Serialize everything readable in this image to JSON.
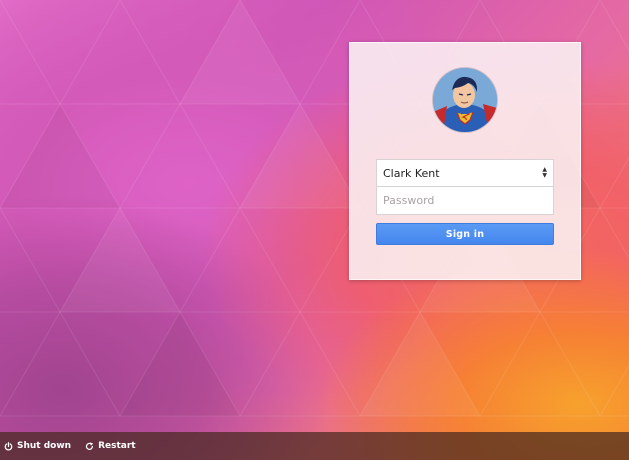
{
  "login": {
    "username": "Clark Kent",
    "password_placeholder": "Password",
    "signin_label": "Sign in",
    "avatar_icon": "superman-avatar"
  },
  "bottom_bar": {
    "shutdown_label": "Shut down",
    "shutdown_icon": "power-icon",
    "restart_label": "Restart",
    "restart_icon": "restart-icon"
  },
  "colors": {
    "signin_button": "#4a8cf0",
    "bottom_bar": "#46281e"
  }
}
